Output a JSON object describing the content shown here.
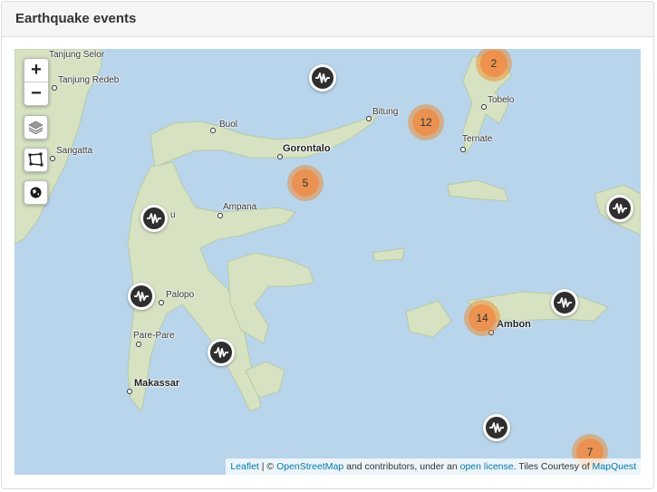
{
  "panel": {
    "title": "Earthquake events"
  },
  "controls": {
    "zoom_in": "+",
    "zoom_out": "−"
  },
  "cities": [
    {
      "name": "Tanjung Selor",
      "major": false
    },
    {
      "name": "Tanjung Redeb",
      "major": false
    },
    {
      "name": "Sangatta",
      "major": false
    },
    {
      "name": "Buol",
      "major": false
    },
    {
      "name": "Gorontalo",
      "major": true
    },
    {
      "name": "Bitung",
      "major": false
    },
    {
      "name": "Tobelo",
      "major": false
    },
    {
      "name": "Ternate",
      "major": false
    },
    {
      "name": "Ampana",
      "major": false
    },
    {
      "name": "Palopo",
      "major": false
    },
    {
      "name": "Pare-Pare",
      "major": false
    },
    {
      "name": "Makassar",
      "major": true
    },
    {
      "name": "Ambon",
      "major": true
    },
    {
      "name": "u",
      "major": false
    }
  ],
  "clusters": [
    {
      "count": "2"
    },
    {
      "count": "12"
    },
    {
      "count": "5"
    },
    {
      "count": "14"
    },
    {
      "count": "7"
    }
  ],
  "attribution": {
    "leaflet": "Leaflet",
    "sep": " | © ",
    "osm": "OpenStreetMap",
    "mid": " and contributors, under an ",
    "license": "open license",
    "tiles": ". Tiles Courtesy of ",
    "mapquest": "MapQuest"
  },
  "colors": {
    "sea": "#b8d5ec",
    "land": "#d6e2c2",
    "cluster": "#f08c46",
    "quake": "#2f2f2f"
  },
  "icons": {
    "quake_marker": "seismograph-icon",
    "layers": "layers-icon",
    "draw": "polygon-draw-icon",
    "locate": "globe-icon"
  }
}
